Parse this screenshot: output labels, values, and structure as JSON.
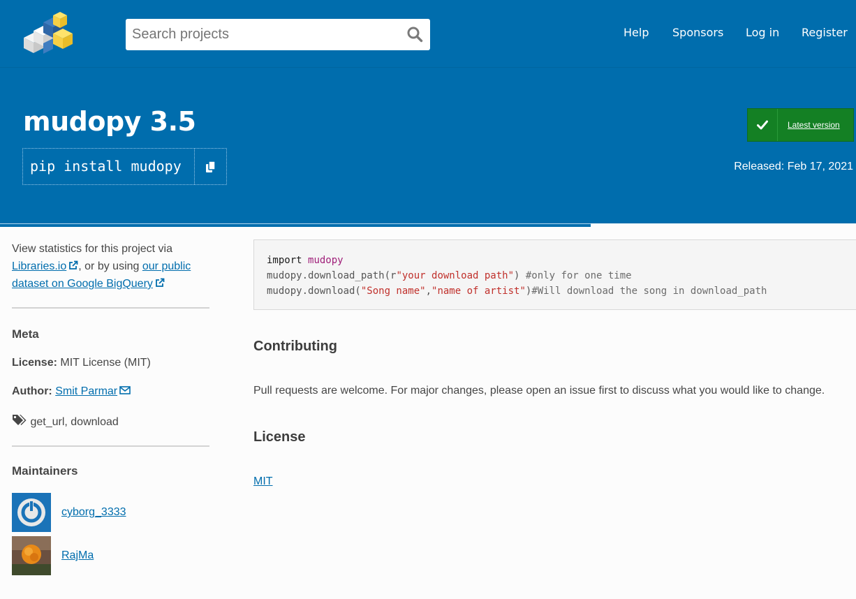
{
  "nav": {
    "search_placeholder": "Search projects",
    "links": [
      "Help",
      "Sponsors",
      "Log in",
      "Register"
    ]
  },
  "package": {
    "title": "mudopy 3.5",
    "pip_command": "pip install mudopy",
    "latest_version_label": "Latest version",
    "released": "Released: Feb 17, 2021",
    "progress_fraction": 0.69
  },
  "sidebar": {
    "stats_text_1": "View statistics for this project via",
    "libraries_link": "Libraries.io",
    "stats_text_2": ", or by using",
    "bigquery_link_1": "our public",
    "bigquery_link_2": "dataset on Google BigQuery",
    "meta_heading": "Meta",
    "license_label": "License:",
    "license_value": "MIT License (MIT)",
    "author_label": "Author:",
    "author_value": "Smit Parmar",
    "keywords": "get_url, download",
    "maintainers_heading": "Maintainers",
    "maintainers": [
      "cyborg_3333",
      "RajMa"
    ]
  },
  "main": {
    "code_line1_kw": "import",
    "code_line1_mod": "mudopy",
    "code_line2_a": "mudopy.download_path(r",
    "code_line2_str": "\"your download path\"",
    "code_line2_b": ") ",
    "code_line2_cmt": "#only for one time",
    "code_line3_a": "mudopy.download(",
    "code_line3_str1": "\"Song name\"",
    "code_line3_comma": ",",
    "code_line3_str2": "\"name of artist\"",
    "code_line3_b": ")",
    "code_line3_cmt": "#Will download the song in download_path",
    "contributing_heading": "Contributing",
    "contributing_text": "Pull requests are welcome. For major changes, please open an issue first to discuss what you would like to change.",
    "license_heading": "License",
    "license_link": "MIT"
  },
  "colors": {
    "brand_blue": "#006dad",
    "latest_green": "#148024",
    "link_blue": "#006dad"
  }
}
